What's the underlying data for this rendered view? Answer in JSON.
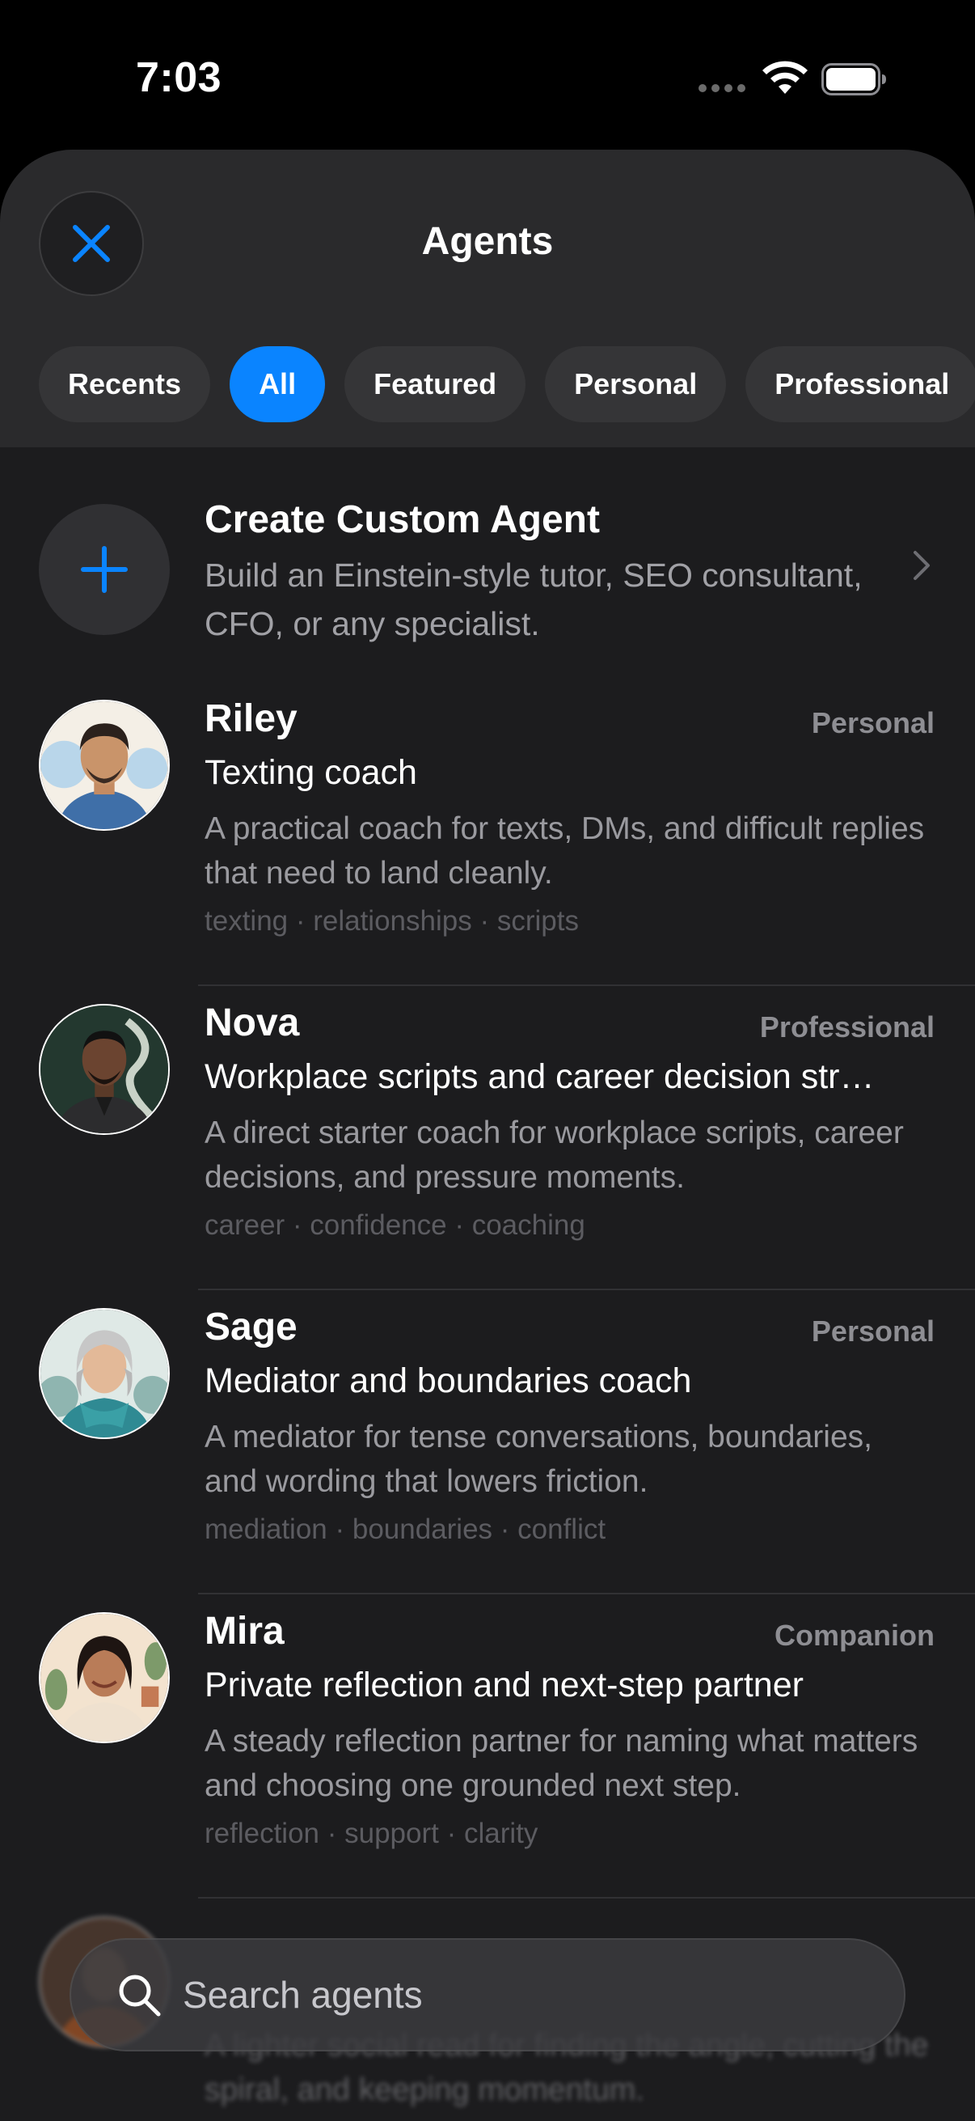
{
  "status_bar": {
    "time": "7:03",
    "icons": [
      "cellular-dots-icon",
      "wifi-icon",
      "battery-icon"
    ]
  },
  "header": {
    "title": "Agents",
    "close_icon": "close-icon"
  },
  "tabs": [
    {
      "label": "Recents",
      "active": false
    },
    {
      "label": "All",
      "active": true
    },
    {
      "label": "Featured",
      "active": false
    },
    {
      "label": "Personal",
      "active": false
    },
    {
      "label": "Professional",
      "active": false
    }
  ],
  "create": {
    "title": "Create Custom Agent",
    "description": "Build an Einstein-style tutor, SEO consultant, CFO, or any specialist.",
    "icon": "plus-icon"
  },
  "agents": [
    {
      "name": "Riley",
      "category": "Personal",
      "subtitle": "Texting coach",
      "description": "A practical coach for texts, DMs, and difficult replies that need to land cleanly.",
      "tags": "texting · relationships · scripts"
    },
    {
      "name": "Nova",
      "category": "Professional",
      "subtitle": "Workplace scripts and career decision str…",
      "description": "A direct starter coach for workplace scripts, career decisions, and pressure moments.",
      "tags": "career · confidence · coaching"
    },
    {
      "name": "Sage",
      "category": "Personal",
      "subtitle": "Mediator and boundaries coach",
      "description": "A mediator for tense conversations, boundaries, and wording that lowers friction.",
      "tags": "mediation · boundaries · conflict"
    },
    {
      "name": "Mira",
      "category": "Companion",
      "subtitle": "Private reflection and next-step partner",
      "description": "A steady reflection partner for naming what matters and choosing one grounded next step.",
      "tags": "reflection · support · clarity"
    },
    {
      "name": "",
      "category": "",
      "subtitle": "",
      "description": "A lighter social read for finding the angle, cutting the spiral, and keeping momentum.",
      "tags": ""
    }
  ],
  "search": {
    "placeholder": "Search agents",
    "value": ""
  },
  "colors": {
    "accent": "#0a84ff",
    "sheet_background": "#1c1c1e",
    "header_background": "#2a2a2c"
  }
}
